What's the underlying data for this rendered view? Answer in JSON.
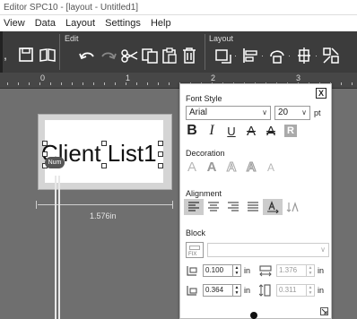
{
  "window": {
    "title": "Editor SPC10 - [layout - Untitled1]"
  },
  "menu": {
    "items": [
      "View",
      "Data",
      "Layout",
      "Settings",
      "Help"
    ]
  },
  "ribbon": {
    "edit_label": "Edit",
    "layout_label": "Layout"
  },
  "ruler": {
    "marks": [
      "0",
      "1",
      "2",
      "3"
    ]
  },
  "canvas": {
    "label_text": "Client List1",
    "num_badge": "Num",
    "width_text": "1.576in"
  },
  "panel": {
    "close_glyph": "X",
    "font_style": {
      "heading": "Font Style",
      "font_name": "Arial",
      "font_size": "20",
      "size_unit": "pt",
      "buttons": {
        "bold": "B",
        "italic": "I",
        "underline": "U",
        "strike": "A",
        "double_strike": "A",
        "reverse": "R"
      }
    },
    "decoration": {
      "heading": "Decoration",
      "options": [
        "A",
        "A",
        "A",
        "A",
        "A"
      ]
    },
    "alignment": {
      "heading": "Alignment"
    },
    "block": {
      "heading": "Block",
      "fix_label": "FIX",
      "x": "0.100",
      "y": "0.364",
      "width": "1.376",
      "height": "0.311",
      "unit": "in"
    }
  }
}
